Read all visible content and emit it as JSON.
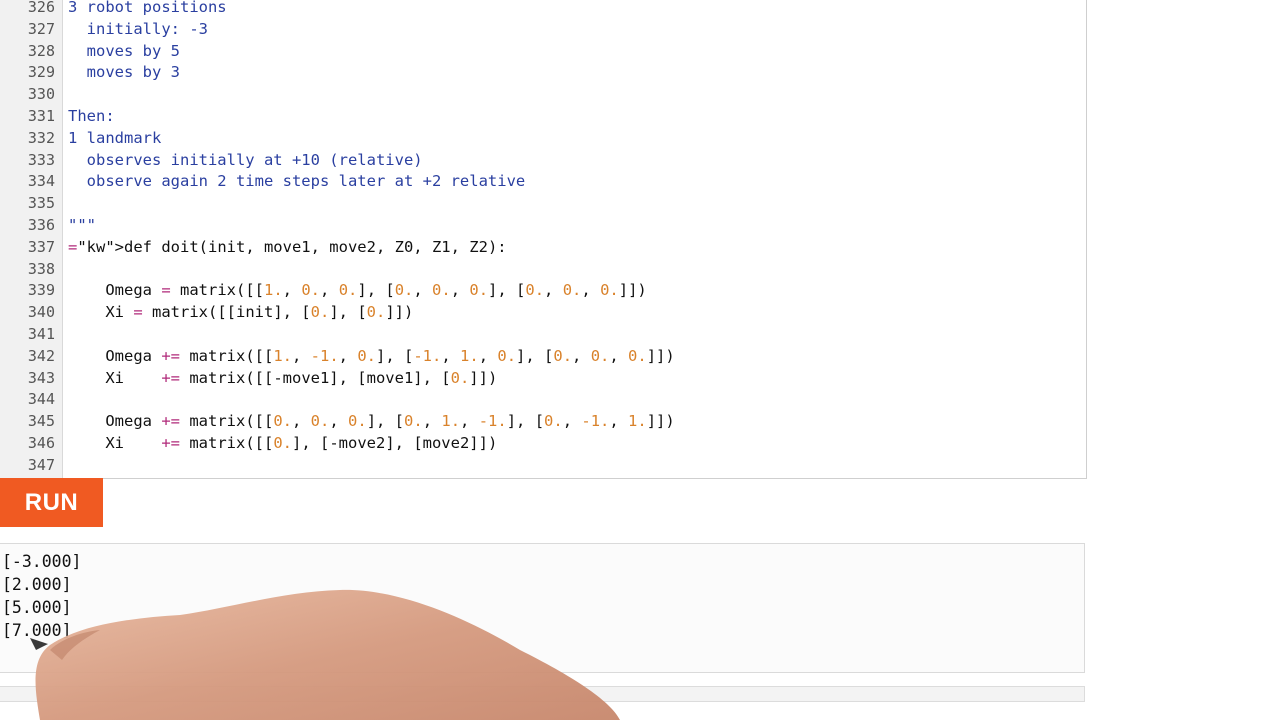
{
  "editor": {
    "lines": [
      {
        "no": "326",
        "code": "3 robot positions",
        "style": "doc"
      },
      {
        "no": "327",
        "code": "  initially: -3",
        "style": "doc"
      },
      {
        "no": "328",
        "code": "  moves by 5",
        "style": "doc"
      },
      {
        "no": "329",
        "code": "  moves by 3",
        "style": "doc"
      },
      {
        "no": "330",
        "code": "",
        "style": "doc"
      },
      {
        "no": "331",
        "code": "Then:",
        "style": "doc"
      },
      {
        "no": "332",
        "code": "1 landmark",
        "style": "doc"
      },
      {
        "no": "333",
        "code": "  observes initially at +10 (relative)",
        "style": "doc"
      },
      {
        "no": "334",
        "code": "  observe again 2 time steps later at +2 relative",
        "style": "doc"
      },
      {
        "no": "335",
        "code": "",
        "style": "doc"
      },
      {
        "no": "336",
        "code": "\"\"\"",
        "style": "doc"
      },
      {
        "no": "337",
        "code": "def doit(init, move1, move2, Z0, Z1, Z2):",
        "style": "code"
      },
      {
        "no": "338",
        "code": "",
        "style": "code"
      },
      {
        "no": "339",
        "code": "    Omega = matrix([[1., 0., 0.], [0., 0., 0.], [0., 0., 0.]])",
        "style": "code"
      },
      {
        "no": "340",
        "code": "    Xi = matrix([[init], [0.], [0.]])",
        "style": "code"
      },
      {
        "no": "341",
        "code": "",
        "style": "code"
      },
      {
        "no": "342",
        "code": "    Omega += matrix([[1., -1., 0.], [-1., 1., 0.], [0., 0., 0.]])",
        "style": "code"
      },
      {
        "no": "343",
        "code": "    Xi    += matrix([[-move1], [move1], [0.]])",
        "style": "code"
      },
      {
        "no": "344",
        "code": "",
        "style": "code"
      },
      {
        "no": "345",
        "code": "    Omega += matrix([[0., 0., 0.], [0., 1., -1.], [0., -1., 1.]])",
        "style": "code"
      },
      {
        "no": "346",
        "code": "    Xi    += matrix([[0.], [-move2], [move2]])",
        "style": "code"
      },
      {
        "no": "347",
        "code": "",
        "style": "code"
      }
    ]
  },
  "run_button": {
    "label": "RUN"
  },
  "output": {
    "lines": [
      "[-3.000]",
      "[2.000]",
      "[5.000]",
      "[7.000]"
    ]
  },
  "colors": {
    "run_button": "#f05a22",
    "docstring": "#2a3fa0",
    "keyword": "#b0297a",
    "number": "#d9822b"
  }
}
